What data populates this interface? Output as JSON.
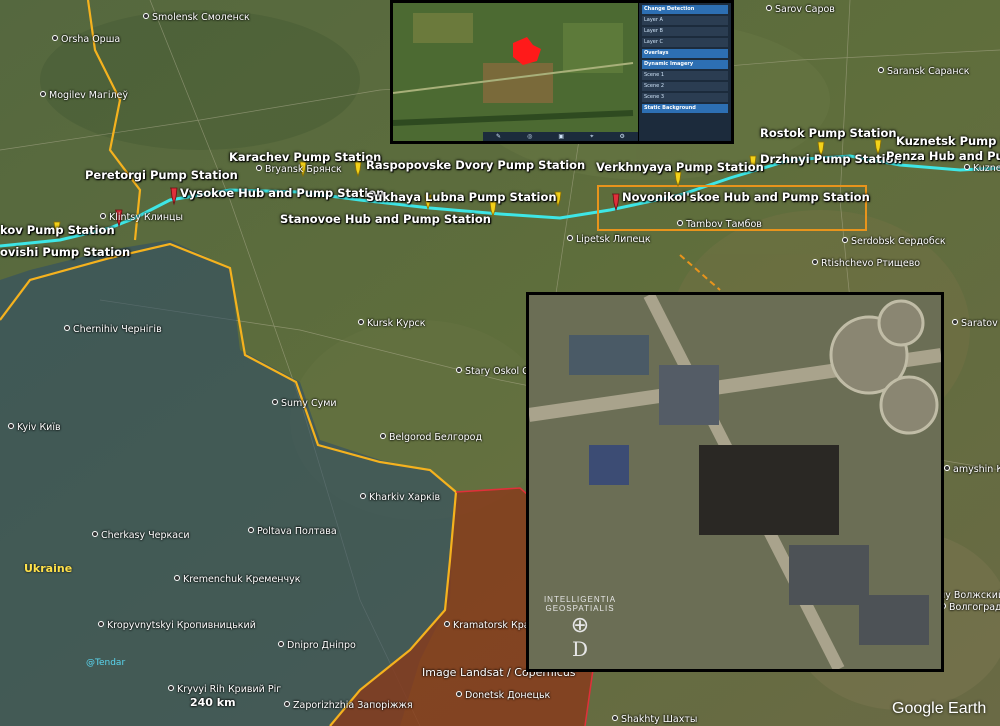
{
  "cities": [
    {
      "name": "Smolensk Смоленск"
    },
    {
      "name": "Orsha Орша"
    },
    {
      "name": "Mogilev Магілеў"
    },
    {
      "name": "Bryansk Брянск"
    },
    {
      "name": "Klintsy Клинцы"
    },
    {
      "name": "Lipetsk Липецк"
    },
    {
      "name": "Tambov Тамбов"
    },
    {
      "name": "Serdobsk Сердобск"
    },
    {
      "name": "Rtishchevo Ртищево"
    },
    {
      "name": "Sarov Саров"
    },
    {
      "name": "Saransk Саранск"
    },
    {
      "name": "Kursk Курск"
    },
    {
      "name": "Stary Oskol Ст"
    },
    {
      "name": "Chernihiv Чернігів"
    },
    {
      "name": "Sumy Суми"
    },
    {
      "name": "Belgorod Белгород"
    },
    {
      "name": "Kyiv Київ"
    },
    {
      "name": "Kharkiv Харків"
    },
    {
      "name": "Poltava Полтава"
    },
    {
      "name": "Cherkasy Черкаси"
    },
    {
      "name": "Kremenchuk Кременчук"
    },
    {
      "name": "Kropyvnytskyi Кропивницький"
    },
    {
      "name": "Dnipro Дніпро"
    },
    {
      "name": "Kryvyi Rih Кривий Ріг"
    },
    {
      "name": "Zaporizhzhia Запоріжжя"
    },
    {
      "name": "Kramatorsk Крама"
    },
    {
      "name": "Donetsk Донецьк"
    },
    {
      "name": "Shakhty Шахты"
    },
    {
      "name": "Saratov Сар"
    },
    {
      "name": "amyshin Кам"
    },
    {
      "name": "ну Волжский"
    },
    {
      "name": "Волгоград"
    },
    {
      "name": "Kuznets"
    }
  ],
  "stations": [
    {
      "name": "Peretorgi Pump Station"
    },
    {
      "name": "Karachev Pump Station"
    },
    {
      "name": "Vysokoe Hub and Pump Station"
    },
    {
      "name": "Raspopovske Dvory Pump Station"
    },
    {
      "name": "Sukhaya Lubna Pump Station"
    },
    {
      "name": "Stanovoe Hub and Pump Station"
    },
    {
      "name": "Verkhnyaya Pump Station"
    },
    {
      "name": "Novonikol'skoe Hub and Pump Station"
    },
    {
      "name": "Drzhnyi Pump Station"
    },
    {
      "name": "Rostok Pump Station"
    },
    {
      "name": "Kuznetsk Pump S"
    },
    {
      "name": "Penza Hub and Pum"
    },
    {
      "name": "kov Pump Station"
    },
    {
      "name": "ovishi Pump Station"
    }
  ],
  "country_label": "Ukraine",
  "handle": "@Tendar",
  "scale": "240 km",
  "attribution": "Image Landsat / Copernicus",
  "logo": "Google Earth",
  "watermark": {
    "line1": "INTELLIGENTIA",
    "line2": "GEOSPATIALIS",
    "letter": "D"
  },
  "colors": {
    "pipeline": "#3ee6e6",
    "border": "#f5b21e",
    "highlight_box": "#e8941c",
    "pin_yellow": "#f3d21a",
    "pin_red": "#e0303a",
    "occupied_zone": "#8a3a1a"
  }
}
